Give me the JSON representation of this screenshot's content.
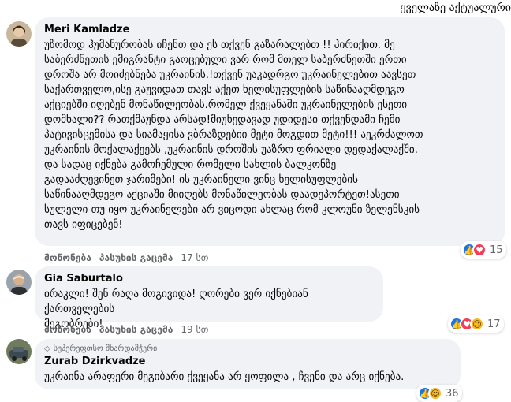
{
  "sort": {
    "label": "ყველაზე აქტუალური"
  },
  "comments": [
    {
      "author": "Meri Kamladze",
      "text": "უზომოდ ჰუმანურობას იჩენთ და ეს თქვენ გაზარალებთ !! პირიქით. მე\nსაბერძნეთის ემიგრანტი გაოცებული ვარ რომ მთელ საბერძნეთში ერთი\nდროშა არ მოიძებნება უკრაინის.!თქვენ უაკადრგო უკრაინელებით აავსეთ\nსაქართველო,ისე გაუვიდათ თავს აქეთ ხელისუფლების საწინააღმდეგო\nაქციებში იღებენ მონაწილეობას.რომელ ქვეყანაში უკრაინელების ესეთი\nდომხალი?? რათქმაუნდა არსად!მიუხედავად უდიდესი თქვენდამი ჩემი\nპატივისცემისა და სიამაყისა ვბრაზდებიი მეტი მოგდით მეტი!!! აეკრძალოთ\nუკრაინის მოქალაქეებს ,უკრაინის დროშის უაზრო ფრიალი დედაქალაქში.\nდა სადაც იქნება გამოჩემული რომელი სახლის ბალკონზე\nგადააძღევინეთ ჯარიმები! ის უკრაინელი ვინც ხელისუფლების\nსაწინააღმდეგო აქციაში მიიღებს მონაწილეობას დაადეპორტეთ!ასეთი\nსულელი თუ იყო უკრაინელები არ ვიცოდი ახლაც რომ კლოუნი ზელენსკის\nთავს იფიცებენ!",
      "like_label": "მოწონება",
      "reply_label": "პასუხის გაცემა",
      "time": "17 სთ",
      "reactions": [
        "like",
        "love"
      ],
      "reaction_count": "15"
    },
    {
      "author": "Gia Saburtalo",
      "text": "ირაკლი! შენ რაღა მოგივიდა! ღორები ვერ იქნებიან ქართველების\nმეგობრები!",
      "like_label": "მოწონება",
      "reply_label": "პასუხის გაცემა",
      "time": "19 სთ",
      "reactions": [
        "like",
        "love",
        "haha"
      ],
      "reaction_count": "17"
    },
    {
      "badge": "სუპერეფთსო მხარდამჭერი",
      "author": "Zurab Dzirkvadze",
      "text": "უკრაინა არაფერი მეგიბარი ქვეყანა არ ყოფილა , ჩვენი და არც იქნება.",
      "reactions": [
        "like",
        "haha"
      ],
      "reaction_count": "36"
    }
  ],
  "colors": {
    "bubble": "#f0f2f5",
    "like": "#1b74e4",
    "love": "#f33e58",
    "haha": "#f7b928",
    "meta": "#65676b"
  }
}
